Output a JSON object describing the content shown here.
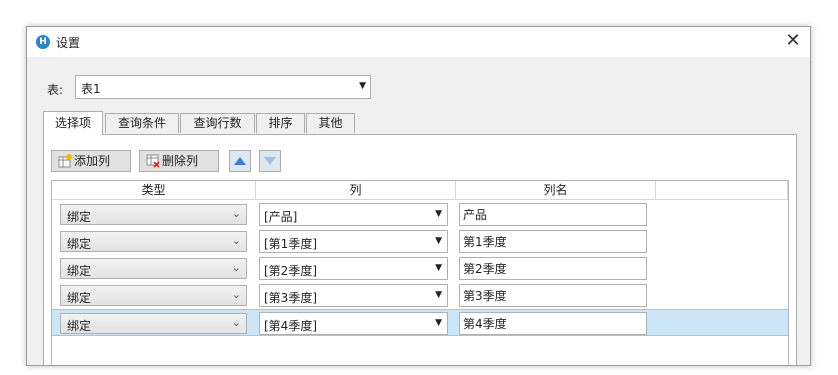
{
  "dialog": {
    "title": "设置",
    "app_icon_letter": "H",
    "close_glyph": "✕"
  },
  "table": {
    "label": "表:",
    "value": "表1"
  },
  "tabs": [
    {
      "label": "选择项",
      "active": true
    },
    {
      "label": "查询条件"
    },
    {
      "label": "查询行数"
    },
    {
      "label": "排序"
    },
    {
      "label": "其他"
    }
  ],
  "toolbar": {
    "add_label": "添加列",
    "delete_label": "删除列",
    "move_up_icon": "triangle-up-icon",
    "move_down_icon": "triangle-down-icon"
  },
  "grid": {
    "headers": [
      "类型",
      "列",
      "列名"
    ],
    "rows": [
      {
        "type": "绑定",
        "column": "[产品]",
        "name": "产品"
      },
      {
        "type": "绑定",
        "column": "[第1季度]",
        "name": "第1季度"
      },
      {
        "type": "绑定",
        "column": "[第2季度]",
        "name": "第2季度"
      },
      {
        "type": "绑定",
        "column": "[第3季度]",
        "name": "第3季度"
      },
      {
        "type": "绑定",
        "column": "[第4季度]",
        "name": "第4季度",
        "selected": true
      }
    ]
  },
  "colors": {
    "selected_row": "#cde6f7",
    "app_icon": "#2b86c5",
    "arrow_active": "#3a7bd5",
    "arrow_disabled": "#9fc0e6"
  }
}
